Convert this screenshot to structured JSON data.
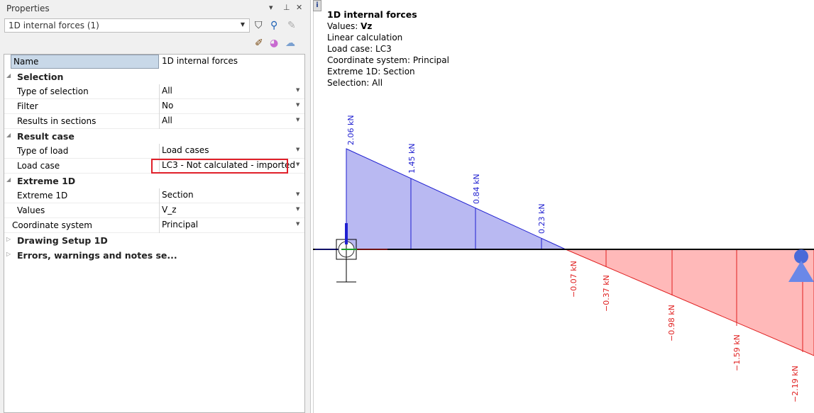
{
  "panel": {
    "title": "Properties",
    "selector_value": "1D internal forces (1)",
    "rows": [
      {
        "type": "name",
        "key": "Name",
        "value": "1D internal forces"
      },
      {
        "type": "group",
        "key": "Selection"
      },
      {
        "type": "prop",
        "key": "Type of selection",
        "value": "All",
        "dropdown": true
      },
      {
        "type": "prop",
        "key": "Filter",
        "value": "No",
        "dropdown": true
      },
      {
        "type": "prop",
        "key": "Results in sections",
        "value": "All",
        "dropdown": true
      },
      {
        "type": "group",
        "key": "Result case"
      },
      {
        "type": "prop",
        "key": "Type of load",
        "value": "Load cases",
        "dropdown": true
      },
      {
        "type": "prop",
        "key": "Load case",
        "value": "LC3 - Not calculated - imported",
        "dropdown": true
      },
      {
        "type": "group",
        "key": "Extreme 1D"
      },
      {
        "type": "prop",
        "key": "Extreme 1D",
        "value": "Section",
        "dropdown": true
      },
      {
        "type": "prop",
        "key": "Values",
        "value": "V_z",
        "dropdown": true
      },
      {
        "type": "prop",
        "key": "Coordinate system",
        "value": "Principal",
        "dropdown": true,
        "outdent": true
      },
      {
        "type": "group-collapsed",
        "key": "Drawing Setup 1D"
      },
      {
        "type": "group-collapsed",
        "key": "Errors, warnings and notes se..."
      }
    ]
  },
  "info": {
    "title": "1D internal forces",
    "values_label": "Values: ",
    "values_value": "Vz",
    "calc": "Linear calculation",
    "load_case": "Load case: LC3",
    "coord": "Coordinate system: Principal",
    "extreme": "Extreme 1D: Section",
    "selection": "Selection: All"
  },
  "diagram": {
    "positive_color": "#b9b9f2",
    "positive_stroke": "#1f1fd0",
    "negative_color": "#ffb9b9",
    "negative_stroke": "#e02020",
    "labels_positive": [
      "2.06 kN",
      "1.45 kN",
      "0.84 kN",
      "0.23 kN"
    ],
    "labels_negative": [
      "−0.07 kN",
      "−0.37 kN",
      "−0.98 kN",
      "−1.59 kN",
      "−2.19 kN"
    ]
  }
}
